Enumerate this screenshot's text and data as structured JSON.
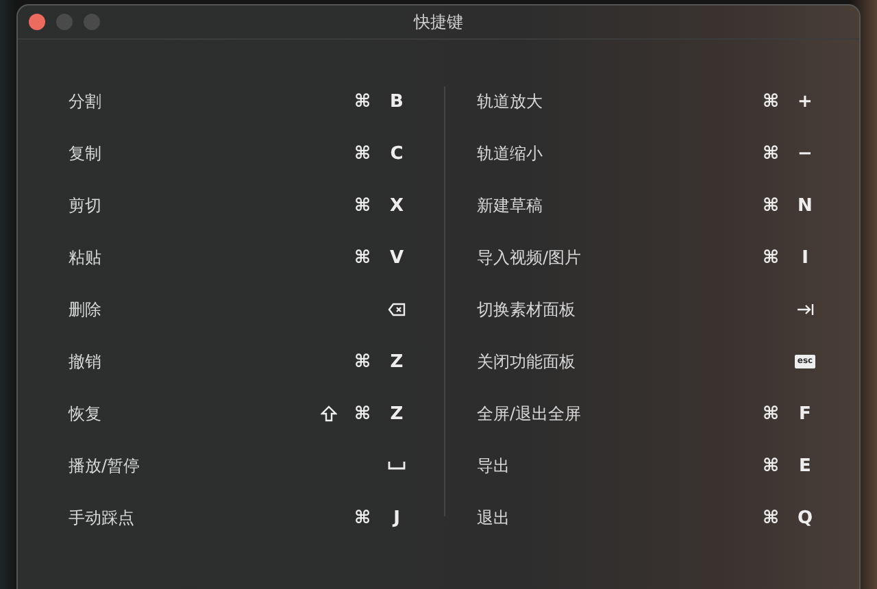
{
  "window": {
    "title": "快捷键",
    "buttons": [
      {
        "kind": "close"
      },
      {
        "kind": "minimize"
      },
      {
        "kind": "zoom"
      }
    ]
  },
  "columns": [
    {
      "shortcuts": [
        {
          "label": "分割",
          "keys": [
            {
              "kind": "char",
              "text": "⌘"
            },
            {
              "kind": "char",
              "text": "B"
            }
          ]
        },
        {
          "label": "复制",
          "keys": [
            {
              "kind": "char",
              "text": "⌘"
            },
            {
              "kind": "char",
              "text": "C"
            }
          ]
        },
        {
          "label": "剪切",
          "keys": [
            {
              "kind": "char",
              "text": "⌘"
            },
            {
              "kind": "char",
              "text": "X"
            }
          ]
        },
        {
          "label": "粘贴",
          "keys": [
            {
              "kind": "char",
              "text": "⌘"
            },
            {
              "kind": "char",
              "text": "V"
            }
          ]
        },
        {
          "label": "删除",
          "keys": [
            {
              "kind": "delete"
            }
          ]
        },
        {
          "label": "撤销",
          "keys": [
            {
              "kind": "char",
              "text": "⌘"
            },
            {
              "kind": "char",
              "text": "Z"
            }
          ]
        },
        {
          "label": "恢复",
          "keys": [
            {
              "kind": "shift"
            },
            {
              "kind": "char",
              "text": "⌘"
            },
            {
              "kind": "char",
              "text": "Z"
            }
          ]
        },
        {
          "label": "播放/暂停",
          "keys": [
            {
              "kind": "space"
            }
          ]
        },
        {
          "label": "手动踩点",
          "keys": [
            {
              "kind": "char",
              "text": "⌘"
            },
            {
              "kind": "char",
              "text": "J"
            }
          ]
        }
      ]
    },
    {
      "shortcuts": [
        {
          "label": "轨道放大",
          "keys": [
            {
              "kind": "char",
              "text": "⌘"
            },
            {
              "kind": "char",
              "text": "+"
            }
          ]
        },
        {
          "label": "轨道缩小",
          "keys": [
            {
              "kind": "char",
              "text": "⌘"
            },
            {
              "kind": "char",
              "text": "−"
            }
          ]
        },
        {
          "label": "新建草稿",
          "keys": [
            {
              "kind": "char",
              "text": "⌘"
            },
            {
              "kind": "char",
              "text": "N"
            }
          ]
        },
        {
          "label": "导入视频/图片",
          "keys": [
            {
              "kind": "char",
              "text": "⌘"
            },
            {
              "kind": "char",
              "text": "I"
            }
          ]
        },
        {
          "label": "切换素材面板",
          "keys": [
            {
              "kind": "tab"
            }
          ]
        },
        {
          "label": "关闭功能面板",
          "keys": [
            {
              "kind": "esc",
              "text": "esc"
            }
          ]
        },
        {
          "label": "全屏/退出全屏",
          "keys": [
            {
              "kind": "char",
              "text": "⌘"
            },
            {
              "kind": "char",
              "text": "F"
            }
          ]
        },
        {
          "label": "导出",
          "keys": [
            {
              "kind": "char",
              "text": "⌘"
            },
            {
              "kind": "char",
              "text": "E"
            }
          ]
        },
        {
          "label": "退出",
          "keys": [
            {
              "kind": "char",
              "text": "⌘"
            },
            {
              "kind": "char",
              "text": "Q"
            }
          ]
        }
      ]
    }
  ]
}
